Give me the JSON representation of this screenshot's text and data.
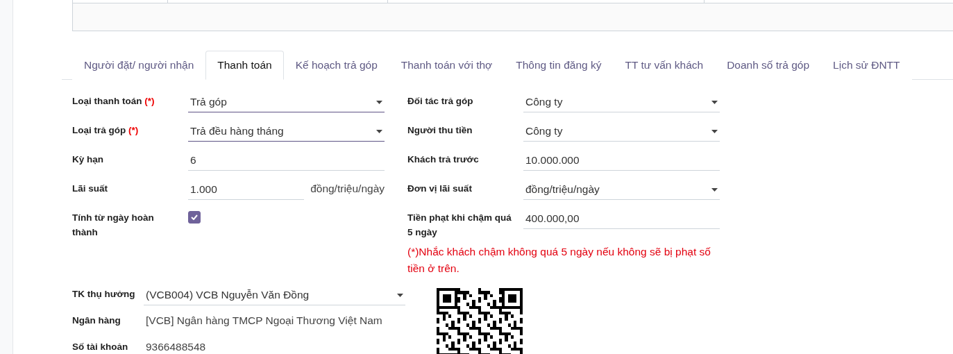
{
  "tabs": [
    {
      "label": "Người đặt/ người nhận",
      "selected": false
    },
    {
      "label": "Thanh toán",
      "selected": true
    },
    {
      "label": "Kế hoạch trả góp",
      "selected": false
    },
    {
      "label": "Thanh toán với thợ",
      "selected": false
    },
    {
      "label": "Thông tin đăng ký",
      "selected": false
    },
    {
      "label": "TT tư vấn khách",
      "selected": false
    },
    {
      "label": "Doanh số trả góp",
      "selected": false
    },
    {
      "label": "Lịch sử ĐNTT",
      "selected": false
    }
  ],
  "left_fields": [
    {
      "label": "Loại thanh toán",
      "required_mark": "(*)",
      "kind": "select",
      "value": "Trả góp",
      "required": true
    },
    {
      "label": "Loại trả góp",
      "required_mark": "(*)",
      "kind": "select",
      "value": "Trả đều hàng tháng",
      "required": true
    },
    {
      "label": "Kỳ hạn",
      "kind": "text",
      "value": "6",
      "required": false
    },
    {
      "label": "Lãi suất",
      "kind": "unit",
      "value": "1.000",
      "unit": "đồng/triệu/ngày",
      "required": false
    },
    {
      "label": "Tính từ ngày hoàn thành",
      "kind": "checkbox",
      "checked": true
    }
  ],
  "right_fields": [
    {
      "label": "Đối tác trả góp",
      "kind": "select",
      "value": "Công ty",
      "required": false
    },
    {
      "label": "Người thu tiền",
      "kind": "select",
      "value": "Công ty",
      "required": false
    },
    {
      "label": "Khách trả trước",
      "kind": "text",
      "value": "10.000.000",
      "required": false
    },
    {
      "label": "Đơn vị lãi suất",
      "kind": "select",
      "value": "đồng/triệu/ngày",
      "required": false
    },
    {
      "label": "Tiền phạt khi chậm quá 5 ngày",
      "kind": "text",
      "value": "400.000,00",
      "required": false
    }
  ],
  "note": "(*)Nhắc khách chậm không quá 5 ngày nếu không sẽ bị phạt số tiền ở trên.",
  "bank_fields": [
    {
      "label": "TK thụ hưởng",
      "kind": "select",
      "value": "(VCB004) VCB Nguyễn Văn Đồng",
      "required": false
    },
    {
      "label": "Ngân hàng",
      "kind": "plain",
      "value": "[VCB] Ngân hàng TMCP Ngoại Thương Việt Nam"
    },
    {
      "label": "Số tài khoản",
      "kind": "plain",
      "value": "9366488548"
    }
  ]
}
